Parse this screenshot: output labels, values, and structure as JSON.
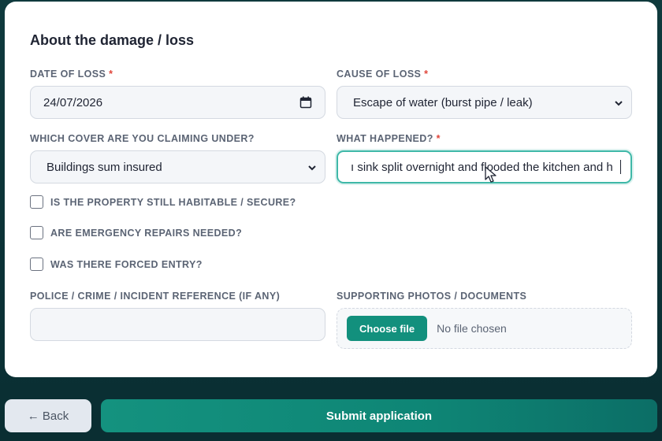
{
  "section": {
    "title": "About the damage / loss"
  },
  "fields": {
    "date_of_loss": {
      "label": "DATE OF LOSS",
      "required_mark": "*",
      "value": "24/07/2026"
    },
    "cause_of_loss": {
      "label": "CAUSE OF LOSS",
      "required_mark": "*",
      "selected": "Escape of water (burst pipe / leak)"
    },
    "cover": {
      "label": "WHICH COVER ARE YOU CLAIMING UNDER?",
      "selected": "Buildings sum insured"
    },
    "what_happened": {
      "label": "WHAT HAPPENED?",
      "required_mark": "*",
      "value": "ı sink split overnight and flooded the kitchen and h"
    },
    "police_ref": {
      "label": "POLICE / CRIME / INCIDENT REFERENCE (IF ANY)",
      "value": ""
    },
    "supporting_docs": {
      "label": "SUPPORTING PHOTOS / DOCUMENTS",
      "button_label": "Choose file",
      "status": "No file chosen"
    }
  },
  "checkboxes": [
    {
      "label": "IS THE PROPERTY STILL HABITABLE / SECURE?",
      "checked": false
    },
    {
      "label": "ARE EMERGENCY REPAIRS NEEDED?",
      "checked": false
    },
    {
      "label": "WAS THERE FORCED ENTRY?",
      "checked": false
    }
  ],
  "footer": {
    "back_label": "← Back",
    "submit_label": "Submit application"
  },
  "icons": {
    "date_picker": "calendar-icon",
    "select_caret": "chevron-down-icon",
    "pointer": "mouse-cursor-icon"
  },
  "colors": {
    "accent": "#12907d",
    "required": "#e0453a",
    "focus_ring": "#3fb8a8"
  }
}
